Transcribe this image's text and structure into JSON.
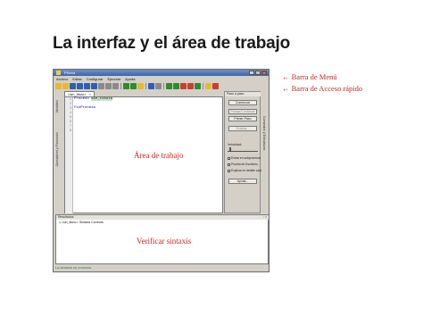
{
  "slide": {
    "title": "La interfaz y el área de trabajo",
    "callout_menu": "← Barra de Menú",
    "callout_toolbar": "← Barra de Acceso rápido",
    "label_work_area": "Área de trabajo",
    "label_verify": "Verificar sintaxis"
  },
  "window": {
    "title": "PSeInt"
  },
  "menu": {
    "items": [
      "Archivo",
      "Editar",
      "Configurar",
      "Ejecutar",
      "Ayuda"
    ]
  },
  "toolbar": {
    "icons": [
      "new-file-icon",
      "open-folder-icon",
      "save-icon",
      "save-as-icon",
      "undo-icon",
      "redo-icon",
      "cut-icon",
      "copy-icon",
      "paste-icon",
      "sep",
      "find-icon",
      "find-next-icon",
      "replace-icon",
      "sep",
      "indent-icon",
      "comment-icon",
      "sep",
      "run-icon",
      "step-icon",
      "debug-icon",
      "stop-icon",
      "flowchart-icon",
      "sep",
      "help-icon",
      "exit-icon"
    ],
    "colors": {
      "blue": "#2f5fb3",
      "green": "#2e8b2e",
      "red": "#c7402d",
      "yellow": "#e8b930",
      "grey": "#8a8a8a"
    }
  },
  "editor": {
    "tab_label": "<sin_titulo>",
    "tab_close": "×",
    "line_numbers": [
      "1",
      "2",
      "3",
      "4",
      "5",
      "6",
      "7",
      "8"
    ],
    "code_keyword_1": "Proceso",
    "code_name": "sin_titulo",
    "code_keyword_2": "FinProceso"
  },
  "side_left": {
    "label_1": "Variables",
    "label_2": "Operadores y Funciones"
  },
  "exec_panel": {
    "header": "Paso a paso",
    "buttons": [
      "Comenzar",
      "Pausar/Continuar",
      "Primer Paso",
      "Evaluar..."
    ],
    "disabled_buttons": [
      false,
      true,
      false,
      true
    ],
    "speed_label": "Velocidad:",
    "speed_level": 0.05,
    "checks": [
      {
        "label": "Entrar en subprocesos",
        "checked": true
      },
      {
        "label": "Prueba de Escritorio",
        "checked": false
      },
      {
        "label": "Explicar en detalle c/paso",
        "checked": false
      }
    ],
    "help_button": "Ayuda..."
  },
  "side_right": {
    "label": "Comandos y Estructuras"
  },
  "results": {
    "header": "Resultados",
    "controls": "▫ ×",
    "message": "<sin_titulo>: Sintaxis Correcta"
  },
  "statusbar": {
    "text": "La sintaxis es correcta."
  }
}
